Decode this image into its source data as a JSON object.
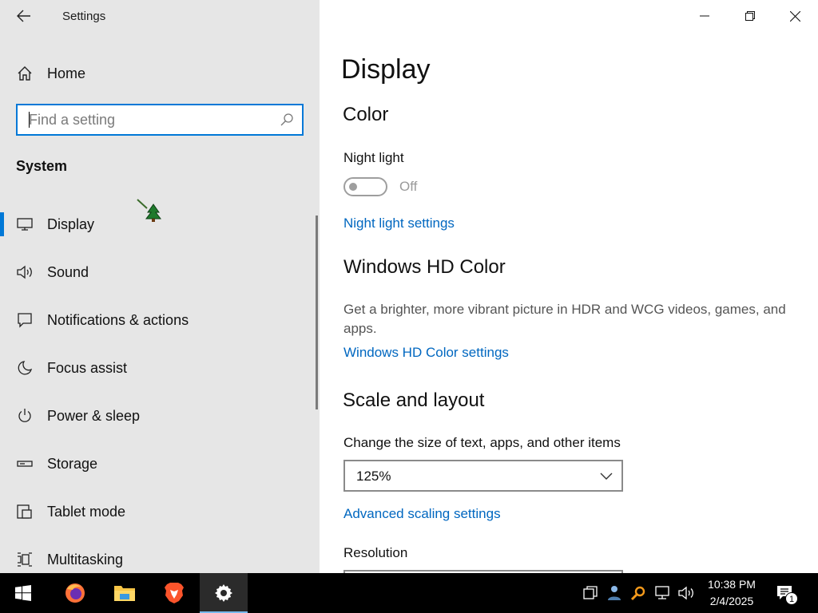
{
  "window": {
    "title": "Settings"
  },
  "sidebar": {
    "home_label": "Home",
    "search_placeholder": "Find a setting",
    "section_heading": "System",
    "items": [
      {
        "label": "Display",
        "icon": "monitor-icon",
        "selected": true
      },
      {
        "label": "Sound",
        "icon": "speaker-icon",
        "selected": false
      },
      {
        "label": "Notifications & actions",
        "icon": "notification-icon",
        "selected": false
      },
      {
        "label": "Focus assist",
        "icon": "moon-icon",
        "selected": false
      },
      {
        "label": "Power & sleep",
        "icon": "power-icon",
        "selected": false
      },
      {
        "label": "Storage",
        "icon": "storage-icon",
        "selected": false
      },
      {
        "label": "Tablet mode",
        "icon": "tablet-mode-icon",
        "selected": false
      },
      {
        "label": "Multitasking",
        "icon": "multitasking-icon",
        "selected": false
      }
    ]
  },
  "main": {
    "page_title": "Display",
    "color": {
      "heading": "Color",
      "night_light_label": "Night light",
      "night_light_state": "Off",
      "night_light_on": false,
      "night_light_settings_link": "Night light settings"
    },
    "hd_color": {
      "heading": "Windows HD Color",
      "description": "Get a brighter, more vibrant picture in HDR and WCG videos, games, and apps.",
      "settings_link": "Windows HD Color settings"
    },
    "scale_layout": {
      "heading": "Scale and layout",
      "change_size_label": "Change the size of text, apps, and other items",
      "scale_value": "125%",
      "advanced_link": "Advanced scaling settings",
      "resolution_label": "Resolution"
    }
  },
  "taskbar": {
    "time": "10:38 PM",
    "date": "2/4/2025",
    "notification_count": "1",
    "pinned": [
      "start-icon",
      "firefox-icon",
      "file-explorer-icon",
      "brave-icon",
      "settings-icon"
    ],
    "active_app": "settings-icon"
  },
  "colors": {
    "accent": "#0078d7",
    "link": "#0067c0",
    "sidebar_bg": "#e6e6e6",
    "taskbar_bg": "#000000"
  }
}
